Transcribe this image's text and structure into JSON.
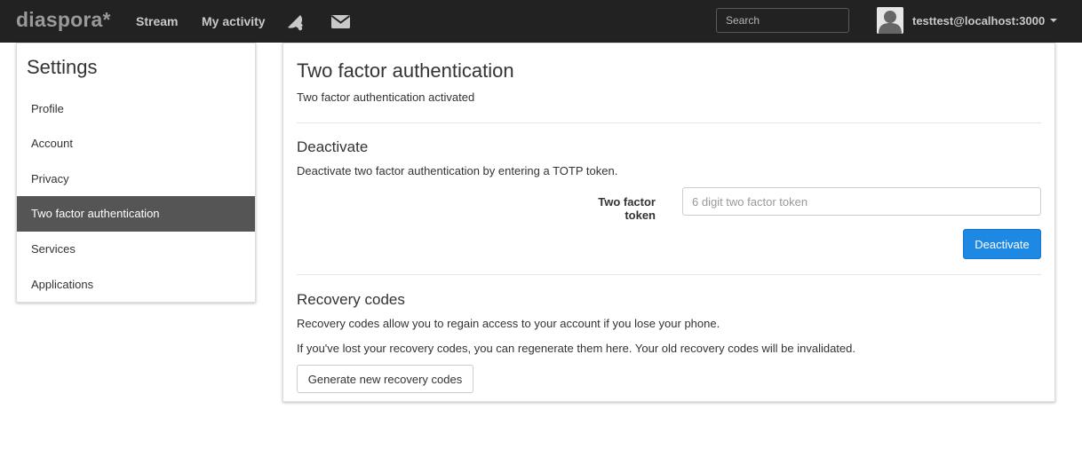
{
  "navbar": {
    "brand": "diaspora*",
    "links": [
      {
        "label": "Stream"
      },
      {
        "label": "My activity"
      }
    ],
    "icons": [
      "notifications-bell-icon",
      "envelope-mail-icon"
    ],
    "search_placeholder": "Search",
    "user_name": "testtest@localhost:3000",
    "background_color": "#222222"
  },
  "sidebar": {
    "title": "Settings",
    "items": [
      {
        "label": "Profile",
        "active": false
      },
      {
        "label": "Account",
        "active": false
      },
      {
        "label": "Privacy",
        "active": false
      },
      {
        "label": "Two factor authentication",
        "active": true
      },
      {
        "label": "Services",
        "active": false
      },
      {
        "label": "Applications",
        "active": false
      }
    ],
    "active_color": "#555555"
  },
  "main": {
    "title": "Two factor authentication",
    "status": "Two factor authentication activated",
    "deactivate": {
      "heading": "Deactivate",
      "description": "Deactivate two factor authentication by entering a TOTP token.",
      "token_label": "Two factor token",
      "token_placeholder": "6 digit two factor token",
      "token_value": "",
      "button_label": "Deactivate",
      "button_color": "#1e88e5"
    },
    "recovery": {
      "heading": "Recovery codes",
      "line1": "Recovery codes allow you to regain access to your account if you lose your phone.",
      "line2": "If you've lost your recovery codes, you can regenerate them here. Your old recovery codes will be invalidated.",
      "button_label": "Generate new recovery codes"
    }
  }
}
